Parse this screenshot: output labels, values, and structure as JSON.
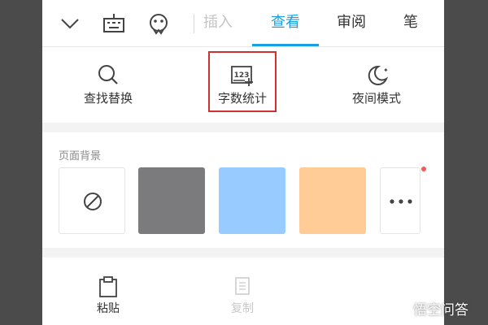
{
  "topbar": {
    "tabs": [
      {
        "label": "插入",
        "state": "faded"
      },
      {
        "label": "查看",
        "state": "active"
      },
      {
        "label": "审阅",
        "state": "normal"
      },
      {
        "label": "笔",
        "state": "normal"
      }
    ]
  },
  "tools": [
    {
      "label": "查找替换",
      "icon": "search-icon"
    },
    {
      "label": "字数统计",
      "icon": "word-count-icon",
      "icon_text": "123"
    },
    {
      "label": "夜间模式",
      "icon": "moon-icon"
    }
  ],
  "page_background": {
    "title": "页面背景",
    "swatches": [
      {
        "type": "none",
        "icon": "no-background-icon"
      },
      {
        "type": "color",
        "color": "#7b7a7c"
      },
      {
        "type": "color",
        "color": "#98cbff"
      },
      {
        "type": "color",
        "color": "#ffcb97"
      },
      {
        "type": "more",
        "icon": "more-dots-icon"
      }
    ]
  },
  "bottom": [
    {
      "label": "粘贴",
      "icon": "clipboard-icon",
      "state": "normal"
    },
    {
      "label": "复制",
      "icon": "copy-icon",
      "state": "faded"
    }
  ],
  "watermark": {
    "text": "悟空问答"
  },
  "colors": {
    "accent": "#1aa0e0",
    "highlight_border": "#d03030"
  }
}
